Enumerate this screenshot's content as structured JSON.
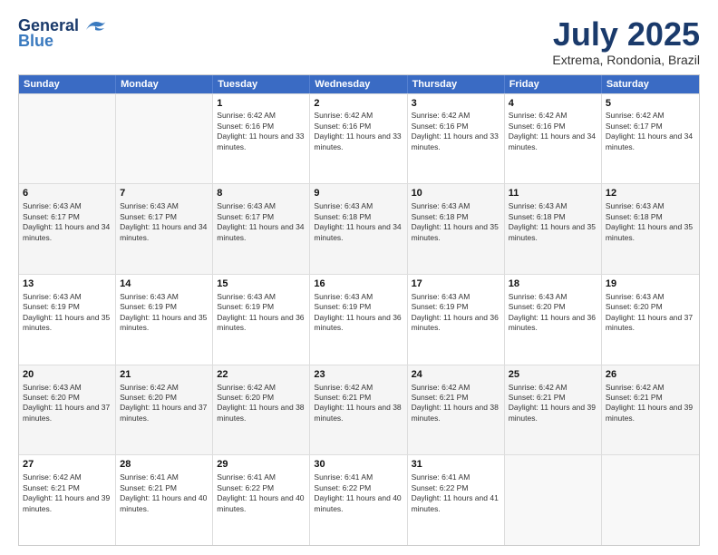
{
  "logo": {
    "line1": "General",
    "line2": "Blue"
  },
  "title": "July 2025",
  "subtitle": "Extrema, Rondonia, Brazil",
  "header_days": [
    "Sunday",
    "Monday",
    "Tuesday",
    "Wednesday",
    "Thursday",
    "Friday",
    "Saturday"
  ],
  "weeks": [
    [
      {
        "day": "",
        "empty": true
      },
      {
        "day": "",
        "empty": true
      },
      {
        "day": "1",
        "sunrise": "Sunrise: 6:42 AM",
        "sunset": "Sunset: 6:16 PM",
        "daylight": "Daylight: 11 hours and 33 minutes."
      },
      {
        "day": "2",
        "sunrise": "Sunrise: 6:42 AM",
        "sunset": "Sunset: 6:16 PM",
        "daylight": "Daylight: 11 hours and 33 minutes."
      },
      {
        "day": "3",
        "sunrise": "Sunrise: 6:42 AM",
        "sunset": "Sunset: 6:16 PM",
        "daylight": "Daylight: 11 hours and 33 minutes."
      },
      {
        "day": "4",
        "sunrise": "Sunrise: 6:42 AM",
        "sunset": "Sunset: 6:16 PM",
        "daylight": "Daylight: 11 hours and 34 minutes."
      },
      {
        "day": "5",
        "sunrise": "Sunrise: 6:42 AM",
        "sunset": "Sunset: 6:17 PM",
        "daylight": "Daylight: 11 hours and 34 minutes."
      }
    ],
    [
      {
        "day": "6",
        "sunrise": "Sunrise: 6:43 AM",
        "sunset": "Sunset: 6:17 PM",
        "daylight": "Daylight: 11 hours and 34 minutes."
      },
      {
        "day": "7",
        "sunrise": "Sunrise: 6:43 AM",
        "sunset": "Sunset: 6:17 PM",
        "daylight": "Daylight: 11 hours and 34 minutes."
      },
      {
        "day": "8",
        "sunrise": "Sunrise: 6:43 AM",
        "sunset": "Sunset: 6:17 PM",
        "daylight": "Daylight: 11 hours and 34 minutes."
      },
      {
        "day": "9",
        "sunrise": "Sunrise: 6:43 AM",
        "sunset": "Sunset: 6:18 PM",
        "daylight": "Daylight: 11 hours and 34 minutes."
      },
      {
        "day": "10",
        "sunrise": "Sunrise: 6:43 AM",
        "sunset": "Sunset: 6:18 PM",
        "daylight": "Daylight: 11 hours and 35 minutes."
      },
      {
        "day": "11",
        "sunrise": "Sunrise: 6:43 AM",
        "sunset": "Sunset: 6:18 PM",
        "daylight": "Daylight: 11 hours and 35 minutes."
      },
      {
        "day": "12",
        "sunrise": "Sunrise: 6:43 AM",
        "sunset": "Sunset: 6:18 PM",
        "daylight": "Daylight: 11 hours and 35 minutes."
      }
    ],
    [
      {
        "day": "13",
        "sunrise": "Sunrise: 6:43 AM",
        "sunset": "Sunset: 6:19 PM",
        "daylight": "Daylight: 11 hours and 35 minutes."
      },
      {
        "day": "14",
        "sunrise": "Sunrise: 6:43 AM",
        "sunset": "Sunset: 6:19 PM",
        "daylight": "Daylight: 11 hours and 35 minutes."
      },
      {
        "day": "15",
        "sunrise": "Sunrise: 6:43 AM",
        "sunset": "Sunset: 6:19 PM",
        "daylight": "Daylight: 11 hours and 36 minutes."
      },
      {
        "day": "16",
        "sunrise": "Sunrise: 6:43 AM",
        "sunset": "Sunset: 6:19 PM",
        "daylight": "Daylight: 11 hours and 36 minutes."
      },
      {
        "day": "17",
        "sunrise": "Sunrise: 6:43 AM",
        "sunset": "Sunset: 6:19 PM",
        "daylight": "Daylight: 11 hours and 36 minutes."
      },
      {
        "day": "18",
        "sunrise": "Sunrise: 6:43 AM",
        "sunset": "Sunset: 6:20 PM",
        "daylight": "Daylight: 11 hours and 36 minutes."
      },
      {
        "day": "19",
        "sunrise": "Sunrise: 6:43 AM",
        "sunset": "Sunset: 6:20 PM",
        "daylight": "Daylight: 11 hours and 37 minutes."
      }
    ],
    [
      {
        "day": "20",
        "sunrise": "Sunrise: 6:43 AM",
        "sunset": "Sunset: 6:20 PM",
        "daylight": "Daylight: 11 hours and 37 minutes."
      },
      {
        "day": "21",
        "sunrise": "Sunrise: 6:42 AM",
        "sunset": "Sunset: 6:20 PM",
        "daylight": "Daylight: 11 hours and 37 minutes."
      },
      {
        "day": "22",
        "sunrise": "Sunrise: 6:42 AM",
        "sunset": "Sunset: 6:20 PM",
        "daylight": "Daylight: 11 hours and 38 minutes."
      },
      {
        "day": "23",
        "sunrise": "Sunrise: 6:42 AM",
        "sunset": "Sunset: 6:21 PM",
        "daylight": "Daylight: 11 hours and 38 minutes."
      },
      {
        "day": "24",
        "sunrise": "Sunrise: 6:42 AM",
        "sunset": "Sunset: 6:21 PM",
        "daylight": "Daylight: 11 hours and 38 minutes."
      },
      {
        "day": "25",
        "sunrise": "Sunrise: 6:42 AM",
        "sunset": "Sunset: 6:21 PM",
        "daylight": "Daylight: 11 hours and 39 minutes."
      },
      {
        "day": "26",
        "sunrise": "Sunrise: 6:42 AM",
        "sunset": "Sunset: 6:21 PM",
        "daylight": "Daylight: 11 hours and 39 minutes."
      }
    ],
    [
      {
        "day": "27",
        "sunrise": "Sunrise: 6:42 AM",
        "sunset": "Sunset: 6:21 PM",
        "daylight": "Daylight: 11 hours and 39 minutes."
      },
      {
        "day": "28",
        "sunrise": "Sunrise: 6:41 AM",
        "sunset": "Sunset: 6:21 PM",
        "daylight": "Daylight: 11 hours and 40 minutes."
      },
      {
        "day": "29",
        "sunrise": "Sunrise: 6:41 AM",
        "sunset": "Sunset: 6:22 PM",
        "daylight": "Daylight: 11 hours and 40 minutes."
      },
      {
        "day": "30",
        "sunrise": "Sunrise: 6:41 AM",
        "sunset": "Sunset: 6:22 PM",
        "daylight": "Daylight: 11 hours and 40 minutes."
      },
      {
        "day": "31",
        "sunrise": "Sunrise: 6:41 AM",
        "sunset": "Sunset: 6:22 PM",
        "daylight": "Daylight: 11 hours and 41 minutes."
      },
      {
        "day": "",
        "empty": true
      },
      {
        "day": "",
        "empty": true
      }
    ]
  ]
}
